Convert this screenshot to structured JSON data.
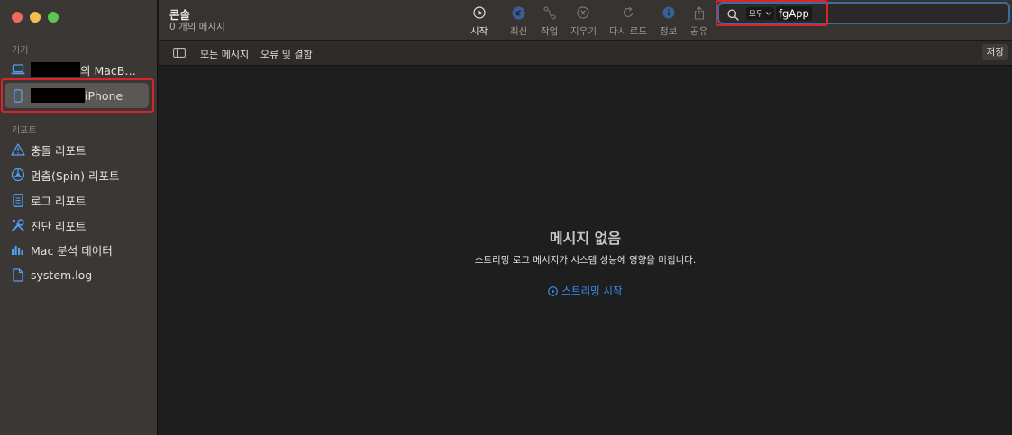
{
  "sidebar": {
    "devices_label": "기기",
    "devices": [
      {
        "suffix": "의 MacB…",
        "icon": "laptop-icon",
        "selected": false
      },
      {
        "suffix": "iPhone",
        "icon": "iphone-icon",
        "selected": true
      }
    ],
    "reports_label": "리포트",
    "reports": [
      {
        "label": "충돌 리포트",
        "icon": "warning-icon"
      },
      {
        "label": "멈춤(Spin) 리포트",
        "icon": "spin-icon"
      },
      {
        "label": "로그 리포트",
        "icon": "document-icon"
      },
      {
        "label": "진단 리포트",
        "icon": "tools-icon"
      },
      {
        "label": "Mac 분석 데이터",
        "icon": "bar-chart-icon"
      },
      {
        "label": "system.log",
        "icon": "file-icon"
      }
    ]
  },
  "toolbar": {
    "title": "콘솔",
    "subtitle": "0 개의 메시지",
    "buttons": [
      {
        "label": "시작",
        "icon": "play-circle-icon"
      },
      {
        "label": "최신",
        "icon": "jump-latest-icon"
      },
      {
        "label": "작업",
        "icon": "activity-icon"
      },
      {
        "label": "지우기",
        "icon": "clear-icon"
      },
      {
        "label": "다시 로드",
        "icon": "reload-icon"
      },
      {
        "label": "정보",
        "icon": "info-icon"
      },
      {
        "label": "공유",
        "icon": "share-icon"
      }
    ],
    "search": {
      "scope": "모두",
      "token": "fgApp"
    }
  },
  "filterbar": {
    "all_messages": "모든 메시지",
    "errors_faults": "오류 및 결함",
    "save": "저장"
  },
  "main": {
    "empty_title": "메시지 없음",
    "empty_desc": "스트리밍 로그 메시지가 시스템 성능에 영향을 미칩니다.",
    "stream_link": "스트리밍 시작"
  },
  "colors": {
    "accent": "#3a8ef6",
    "highlight": "#d9232e",
    "search_focus": "#3d6e9b"
  }
}
